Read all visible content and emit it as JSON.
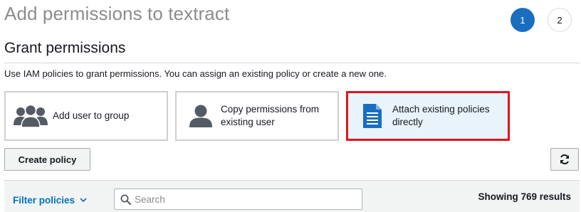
{
  "header": {
    "title": "Add permissions to textract",
    "steps": [
      "1",
      "2"
    ],
    "active_step": "1"
  },
  "section": {
    "title": "Grant permissions",
    "description": "Use IAM policies to grant permissions. You can assign an existing policy or create a new one."
  },
  "options": [
    {
      "label": "Add user to group",
      "icon": "user-group-icon",
      "selected": false
    },
    {
      "label": "Copy permissions from existing user",
      "icon": "user-icon",
      "selected": false
    },
    {
      "label": "Attach existing policies directly",
      "icon": "document-icon",
      "selected": true
    }
  ],
  "toolbar": {
    "create_policy_label": "Create policy",
    "refresh_icon": "refresh-icon"
  },
  "filter": {
    "dropdown_label": "Filter policies",
    "search_placeholder": "Search",
    "search_value": "",
    "results_text": "Showing 769 results"
  },
  "colors": {
    "primary_blue": "#1a6ec0",
    "link_blue": "#0073bb",
    "selection_border": "#e0141e",
    "selected_background": "#e8f3fb",
    "icon_gray": "#545b64"
  }
}
